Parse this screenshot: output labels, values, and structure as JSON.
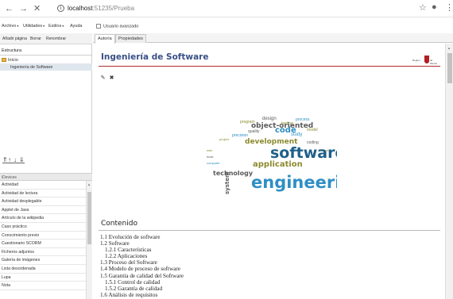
{
  "browser": {
    "back_icon": "arrow-left-icon",
    "forward_icon": "arrow-right-icon",
    "stop_icon": "close-icon",
    "url_host": "localhost",
    "url_path": ":51235/Prueba",
    "star_icon": "star-icon",
    "account_icon": "account-icon",
    "menu_icon": "more-vert-icon"
  },
  "menubar": {
    "items": [
      "Archivo",
      "Utilidades",
      "Estilos",
      "Ayuda"
    ],
    "advanced_user": "Usuario avanzado"
  },
  "left_panel": {
    "toolbar": [
      "Añadir página",
      "Borrar",
      "Renombrar"
    ],
    "structure_title": "Estructura",
    "tree": {
      "root": "Inicio",
      "selected": "Ingeniería de Software"
    },
    "idevices_header": "iDevices",
    "idevices": [
      "Actividad",
      "Actividad de lectura",
      "Actividad desplegable",
      "Applet de Java",
      "Artículo de la wikipedia",
      "Caso práctico",
      "Conocimiento previo",
      "Cuestionario SCORM",
      "Ficheros adjuntos",
      "Galería de imágenes",
      "Lista desordenada",
      "Lupa",
      "Nota"
    ]
  },
  "right_panel": {
    "tabs": [
      "Autoría",
      "Propiedades"
    ],
    "active_tab": "Autoría",
    "title": "Ingeniería de Software",
    "logo_left": "Región",
    "logo_right": "de Murcia",
    "section_title": "Contenido",
    "toc": [
      {
        "level": 1,
        "text": "1.1 Evolución de software"
      },
      {
        "level": 1,
        "text": "1.2 Software"
      },
      {
        "level": 2,
        "text": "1.2.1 Características"
      },
      {
        "level": 2,
        "text": "1.2.2 Aplicaciones"
      },
      {
        "level": 1,
        "text": "1.3 Proceso del Software"
      },
      {
        "level": 1,
        "text": "1.4 Modelo de proceso de software"
      },
      {
        "level": 1,
        "text": "1.5 Garantía de calidad del Software"
      },
      {
        "level": 2,
        "text": "1.5.1 Control de calidad"
      },
      {
        "level": 2,
        "text": "1.5.2 Garantía de calidad"
      },
      {
        "level": 1,
        "text": "1.6 Análisis de requisitos"
      }
    ],
    "wordcloud": {
      "big_words": [
        "software",
        "engineering"
      ],
      "mid_words": [
        "application",
        "technology",
        "development",
        "system",
        "object-oriented",
        "code"
      ],
      "small_words": [
        "program",
        "design",
        "testing",
        "process",
        "quality",
        "model",
        "study",
        "project",
        "coding",
        "precision",
        "web",
        "tools",
        "computer",
        "method"
      ],
      "colors": {
        "blue": "#2f8fc4",
        "dark_blue": "#1f5f8a",
        "olive": "#8c8a2f",
        "gray": "#5a5a5a"
      }
    }
  }
}
